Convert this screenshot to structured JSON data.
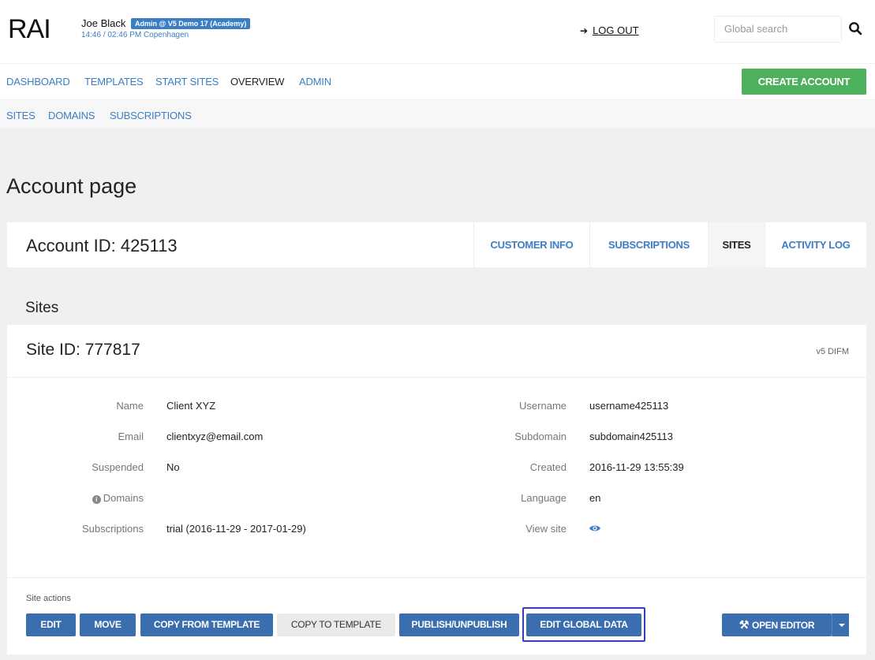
{
  "header": {
    "logo": "RAI",
    "user_name": "Joe Black",
    "user_badge": "Admin @ V5 Demo 17 (Academy)",
    "time": "14:46 / 02:46 PM Copenhagen",
    "logout_label": "LOG OUT",
    "logout_icon": "sign-out-icon",
    "search_placeholder": "Global search",
    "search_icon": "search-icon"
  },
  "nav": {
    "items": [
      "DASHBOARD",
      "TEMPLATES",
      "START SITES",
      "OVERVIEW",
      "ADMIN"
    ],
    "active": "OVERVIEW",
    "create_label": "CREATE ACCOUNT"
  },
  "subnav": {
    "items": [
      "SITES",
      "DOMAINS",
      "SUBSCRIPTIONS"
    ]
  },
  "page": {
    "title": "Account page",
    "account_id": "Account ID: 425113",
    "tabs": [
      "CUSTOMER INFO",
      "SUBSCRIPTIONS",
      "SITES",
      "ACTIVITY LOG"
    ],
    "active_tab": "SITES",
    "sites_heading": "Sites"
  },
  "site": {
    "id": "Site ID: 777817",
    "tag": "v5 DIFM",
    "left": [
      {
        "label": "Name",
        "value": "Client XYZ"
      },
      {
        "label": "Email",
        "value": "clientxyz@email.com"
      },
      {
        "label": "Suspended",
        "value": "No"
      },
      {
        "label": "Domains",
        "value": ""
      },
      {
        "label": "Subscriptions",
        "value": "trial (2016-11-29 - 2017-01-29)"
      }
    ],
    "right": [
      {
        "label": "Username",
        "value": "username425113"
      },
      {
        "label": "Subdomain",
        "value": "subdomain425113"
      },
      {
        "label": "Created",
        "value": "2016-11-29 13:55:39"
      },
      {
        "label": "Language",
        "value": "en"
      },
      {
        "label": "View site",
        "value": ""
      }
    ],
    "actions_label": "Site actions",
    "actions": [
      "EDIT",
      "MOVE",
      "COPY FROM TEMPLATE",
      "COPY TO TEMPLATE",
      "PUBLISH/UNPUBLISH",
      "EDIT GLOBAL DATA"
    ],
    "open_editor_label": "OPEN EDITOR",
    "colors": {
      "accent": "#3b7ec4",
      "button": "#3b6eae",
      "create": "#4cb05c",
      "highlight": "#3a3ac2"
    }
  }
}
